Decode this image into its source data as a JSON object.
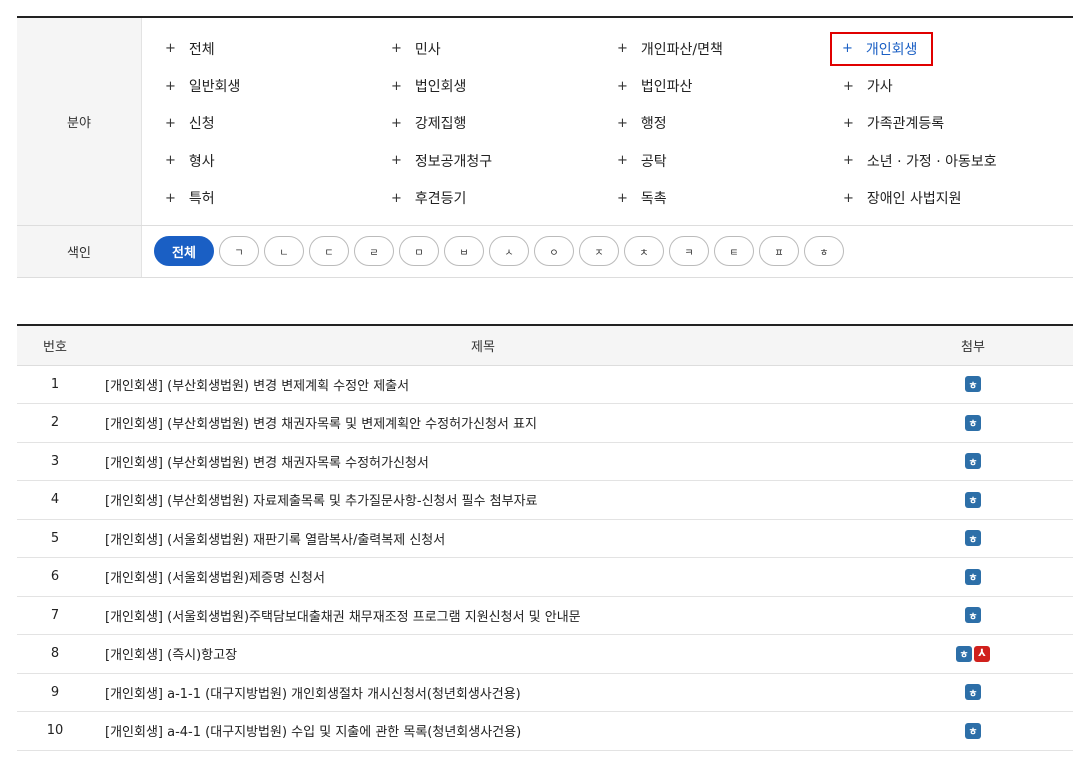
{
  "filter": {
    "category_label": "분야",
    "index_label": "색인",
    "categories": [
      "전체",
      "민사",
      "개인파산/면책",
      "개인회생",
      "일반회생",
      "법인회생",
      "법인파산",
      "가사",
      "신청",
      "강제집행",
      "행정",
      "가족관계등록",
      "형사",
      "정보공개청구",
      "공탁",
      "소년 · 가정 · 아동보호",
      "특허",
      "후견등기",
      "독촉",
      "장애인 사법지원"
    ],
    "selected_category": "개인회생",
    "plus_symbol": "+",
    "index_chips": [
      "전체",
      "ㄱ",
      "ㄴ",
      "ㄷ",
      "ㄹ",
      "ㅁ",
      "ㅂ",
      "ㅅ",
      "ㅇ",
      "ㅈ",
      "ㅊ",
      "ㅋ",
      "ㅌ",
      "ㅍ",
      "ㅎ"
    ],
    "active_chip": "전체"
  },
  "table": {
    "headers": {
      "num": "번호",
      "title": "제목",
      "attach": "첨부"
    },
    "rows": [
      {
        "num": "1",
        "title": "[개인회생] (부산회생법원) 변경 변제계획 수정안 제출서",
        "attachments": [
          "hwp"
        ]
      },
      {
        "num": "2",
        "title": "[개인회생] (부산회생법원) 변경 채권자목록 및 변제계획안 수정허가신청서 표지",
        "attachments": [
          "hwp"
        ]
      },
      {
        "num": "3",
        "title": "[개인회생] (부산회생법원) 변경 채권자목록 수정허가신청서",
        "attachments": [
          "hwp"
        ]
      },
      {
        "num": "4",
        "title": "[개인회생] (부산회생법원) 자료제출목록 및 추가질문사항-신청서 필수 첨부자료",
        "attachments": [
          "hwp"
        ]
      },
      {
        "num": "5",
        "title": "[개인회생] (서울회생법원) 재판기록 열람복사/출력복제 신청서",
        "attachments": [
          "hwp"
        ]
      },
      {
        "num": "6",
        "title": "[개인회생] (서울회생법원)제증명 신청서",
        "attachments": [
          "hwp"
        ]
      },
      {
        "num": "7",
        "title": "[개인회생] (서울회생법원)주택담보대출채권 채무재조정 프로그램 지원신청서 및 안내문",
        "attachments": [
          "hwp"
        ]
      },
      {
        "num": "8",
        "title": "[개인회생] (즉시)항고장",
        "attachments": [
          "hwp",
          "pdf"
        ]
      },
      {
        "num": "9",
        "title": "[개인회생] a-1-1 (대구지방법원) 개인회생절차 개시신청서(청년회생사건용)",
        "attachments": [
          "hwp"
        ]
      },
      {
        "num": "10",
        "title": "[개인회생] a-4-1 (대구지방법원) 수입 및 지출에 관한 목록(청년회생사건용)",
        "attachments": [
          "hwp"
        ]
      }
    ],
    "icons": {
      "hwp": "hwp-file-icon",
      "pdf": "pdf-file-icon"
    },
    "icon_glyphs": {
      "hwp": "ㅎ",
      "pdf": "⅄"
    }
  },
  "colors": {
    "accent": "#1a5fc4",
    "highlight_border": "#e00000",
    "hwp": "#2d6fa8",
    "pdf": "#d0201c"
  }
}
